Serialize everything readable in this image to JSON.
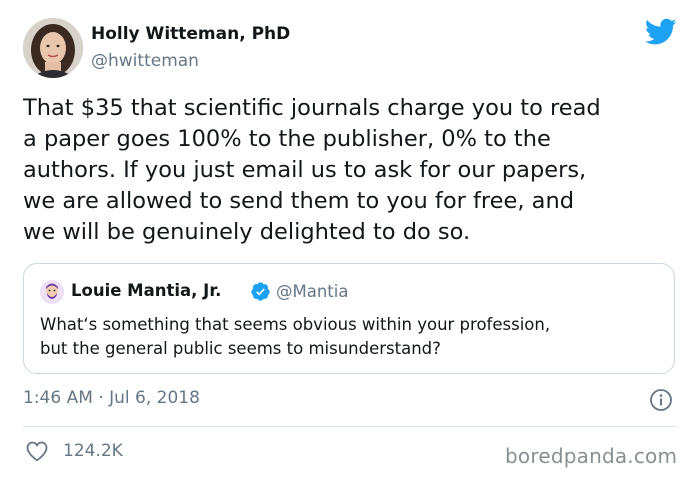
{
  "author": {
    "name": "Holly Witteman, PhD",
    "handle": "@hwitteman"
  },
  "tweet": {
    "text": "That $35 that scientific journals charge you to read\na paper goes 100% to the publisher, 0% to the\nauthors. If you just email us to ask for our papers,\nwe are allowed to send them to you for free, and\nwe will be genuinely delighted to do so."
  },
  "quoted_tweet": {
    "name": "Louie Mantia, Jr.",
    "handle": "@Mantia",
    "text": "What‘s something that seems obvious within your profession,\nbut the general public seems to misunderstand?"
  },
  "meta": {
    "timestamp": "1:46 AM · Jul 6, 2018",
    "likes": "124.2K"
  },
  "watermark": "boredpanda.com",
  "icons": {
    "brand": "twitter-bird-icon",
    "verified": "verified-badge-icon",
    "info": "info-icon",
    "like": "heart-icon"
  },
  "colors": {
    "twitter_blue": "#1da1f2",
    "text": "#14171a",
    "secondary_text": "#657786",
    "border": "#ccd6dd"
  }
}
